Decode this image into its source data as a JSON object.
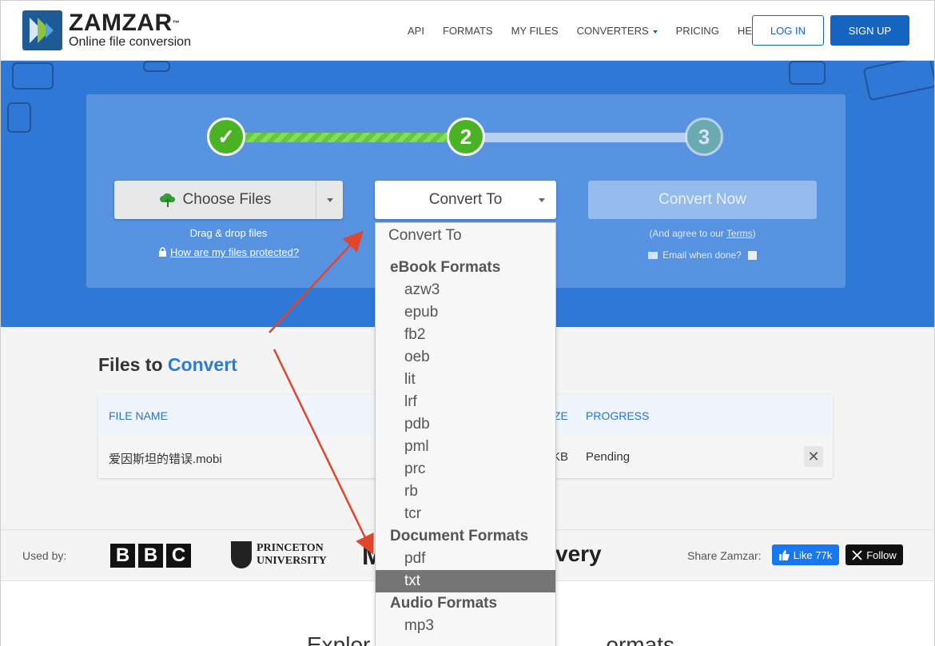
{
  "header": {
    "logo_name": "ZAMZAR",
    "logo_tm": "™",
    "logo_tagline": "Online file conversion",
    "nav": [
      "API",
      "FORMATS",
      "MY FILES",
      "CONVERTERS",
      "PRICING",
      "HELP"
    ],
    "login_label": "LOG IN",
    "signup_label": "SIGN UP"
  },
  "steps": {
    "step1": "✓",
    "step2": "2",
    "step3": "3"
  },
  "upload": {
    "choose_label": "Choose Files",
    "drag_text": "Drag & drop files",
    "protect_link": "How are my files protected?"
  },
  "convert": {
    "select_label": "Convert To",
    "now_label": "Convert Now",
    "agree_prefix": "(And agree to our ",
    "agree_link": "Terms",
    "agree_suffix": ")",
    "email_label": "Email when done?"
  },
  "files": {
    "title_prefix": "Files to ",
    "title_accent": "Convert",
    "columns": {
      "name": "FILE NAME",
      "size": "ZE",
      "progress": "PROGRESS"
    },
    "rows": [
      {
        "name": "爱因斯坦的错误.mobi",
        "size": "KB",
        "progress": "Pending",
        "remove": "✕"
      }
    ]
  },
  "usedby": {
    "label": "Used by:",
    "bbc": [
      "B",
      "B",
      "C"
    ],
    "princeton_line1": "PRINCETON",
    "princeton_line2": "UNIVERSITY",
    "partial_m": "M",
    "partial_very": "very",
    "share_label": "Share Zamzar:",
    "like_label": "Like 77k",
    "follow_label": "Follow"
  },
  "bottom": {
    "explore_left": "Explor",
    "explore_right": "ormats"
  },
  "dropdown": {
    "header": "Convert To",
    "groups": [
      {
        "label": "eBook Formats",
        "items": [
          "azw3",
          "epub",
          "fb2",
          "oeb",
          "lit",
          "lrf",
          "pdb",
          "pml",
          "prc",
          "rb",
          "tcr"
        ]
      },
      {
        "label": "Document Formats",
        "items": [
          "pdf",
          "txt"
        ]
      },
      {
        "label": "Audio Formats",
        "items": [
          "mp3"
        ]
      }
    ],
    "selected": "txt"
  },
  "colors": {
    "brand_blue": "#1565c0",
    "hero_blue": "#2f78d6",
    "step_green": "#49b325",
    "annotation_red": "#e0452d"
  }
}
